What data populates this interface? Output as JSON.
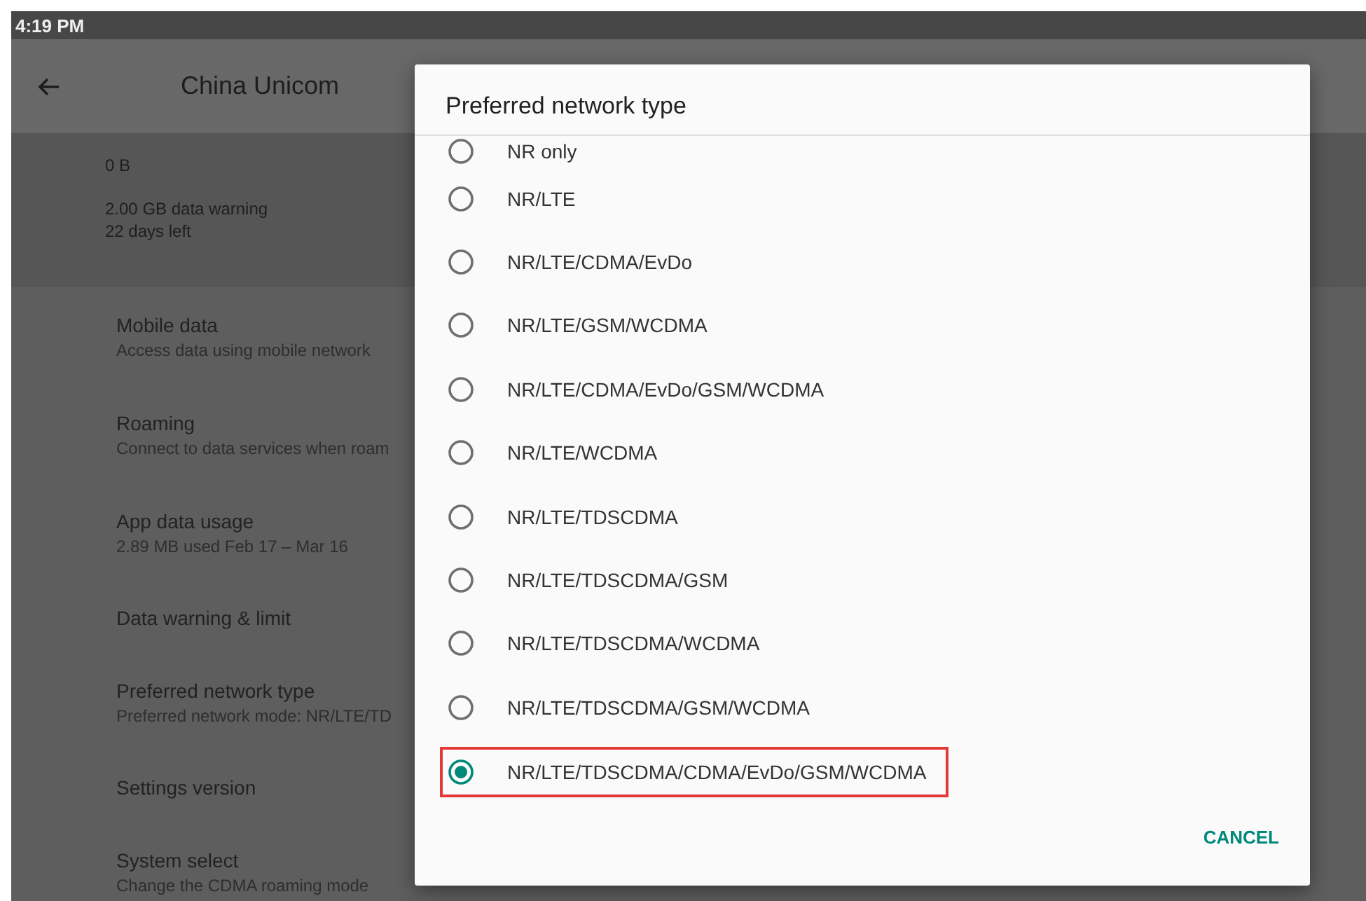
{
  "status_bar": {
    "time": "4:19 PM"
  },
  "app_bar": {
    "title": "China Unicom"
  },
  "usage": {
    "amount": "0 B",
    "warning": "2.00 GB data warning",
    "days_left": "22 days left"
  },
  "settings": [
    {
      "title": "Mobile data",
      "subtitle": "Access data using mobile network"
    },
    {
      "title": "Roaming",
      "subtitle": "Connect to data services when roam"
    },
    {
      "title": "App data usage",
      "subtitle": "2.89 MB used Feb 17 – Mar 16"
    },
    {
      "title": "Data warning & limit"
    },
    {
      "title": "Preferred network type",
      "subtitle": "Preferred network mode: NR/LTE/TD"
    },
    {
      "title": "Settings version"
    },
    {
      "title": "System select",
      "subtitle": "Change the CDMA roaming mode"
    }
  ],
  "dialog": {
    "title": "Preferred network type",
    "options": [
      {
        "label": "NR only",
        "selected": false,
        "highlighted": false
      },
      {
        "label": "NR/LTE",
        "selected": false,
        "highlighted": false
      },
      {
        "label": "NR/LTE/CDMA/EvDo",
        "selected": false,
        "highlighted": false
      },
      {
        "label": "NR/LTE/GSM/WCDMA",
        "selected": false,
        "highlighted": false
      },
      {
        "label": "NR/LTE/CDMA/EvDo/GSM/WCDMA",
        "selected": false,
        "highlighted": false
      },
      {
        "label": "NR/LTE/WCDMA",
        "selected": false,
        "highlighted": false
      },
      {
        "label": "NR/LTE/TDSCDMA",
        "selected": false,
        "highlighted": false
      },
      {
        "label": "NR/LTE/TDSCDMA/GSM",
        "selected": false,
        "highlighted": false
      },
      {
        "label": "NR/LTE/TDSCDMA/WCDMA",
        "selected": false,
        "highlighted": false
      },
      {
        "label": "NR/LTE/TDSCDMA/GSM/WCDMA",
        "selected": false,
        "highlighted": false
      },
      {
        "label": "NR/LTE/TDSCDMA/CDMA/EvDo/GSM/WCDMA",
        "selected": true,
        "highlighted": true
      }
    ],
    "button": "CANCEL"
  }
}
